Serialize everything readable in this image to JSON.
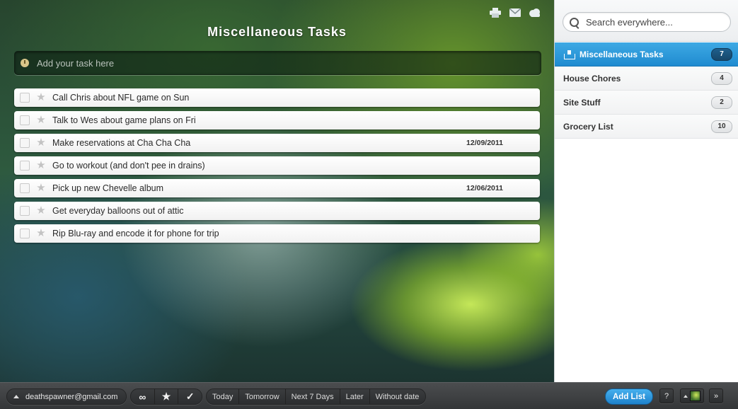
{
  "header": {
    "list_title": "Miscellaneous Tasks",
    "icons": [
      "print-icon",
      "mail-icon",
      "cloud-icon"
    ]
  },
  "add_task": {
    "placeholder": "Add your task here",
    "icon": "clock-icon"
  },
  "tasks": [
    {
      "text": "Call Chris about NFL game on Sun",
      "date": ""
    },
    {
      "text": "Talk to Wes about game plans on Fri",
      "date": ""
    },
    {
      "text": "Make reservations at Cha Cha Cha",
      "date": "12/09/2011"
    },
    {
      "text": "Go to workout (and don't pee in drains)",
      "date": ""
    },
    {
      "text": "Pick up new Chevelle album",
      "date": "12/06/2011"
    },
    {
      "text": "Get everyday balloons out of attic",
      "date": ""
    },
    {
      "text": "Rip Blu-ray and encode it for phone for trip",
      "date": ""
    }
  ],
  "sidebar": {
    "search_placeholder": "Search everywhere...",
    "lists": [
      {
        "name": "Miscellaneous Tasks",
        "count": "7",
        "active": true,
        "icon": "inbox-icon"
      },
      {
        "name": "House Chores",
        "count": "4",
        "active": false
      },
      {
        "name": "Site Stuff",
        "count": "2",
        "active": false
      },
      {
        "name": "Grocery List",
        "count": "10",
        "active": false
      }
    ]
  },
  "bottombar": {
    "account_email": "deathspawner@gmail.com",
    "filter_icons": [
      "infinity-icon",
      "star-icon",
      "check-icon"
    ],
    "date_filters": [
      "Today",
      "Tomorrow",
      "Next 7 Days",
      "Later",
      "Without date"
    ],
    "add_list_label": "Add List",
    "help_label": "?",
    "expand_label": "»"
  },
  "colors": {
    "accent": "#2b96da",
    "active_badge": "#1b537a"
  }
}
